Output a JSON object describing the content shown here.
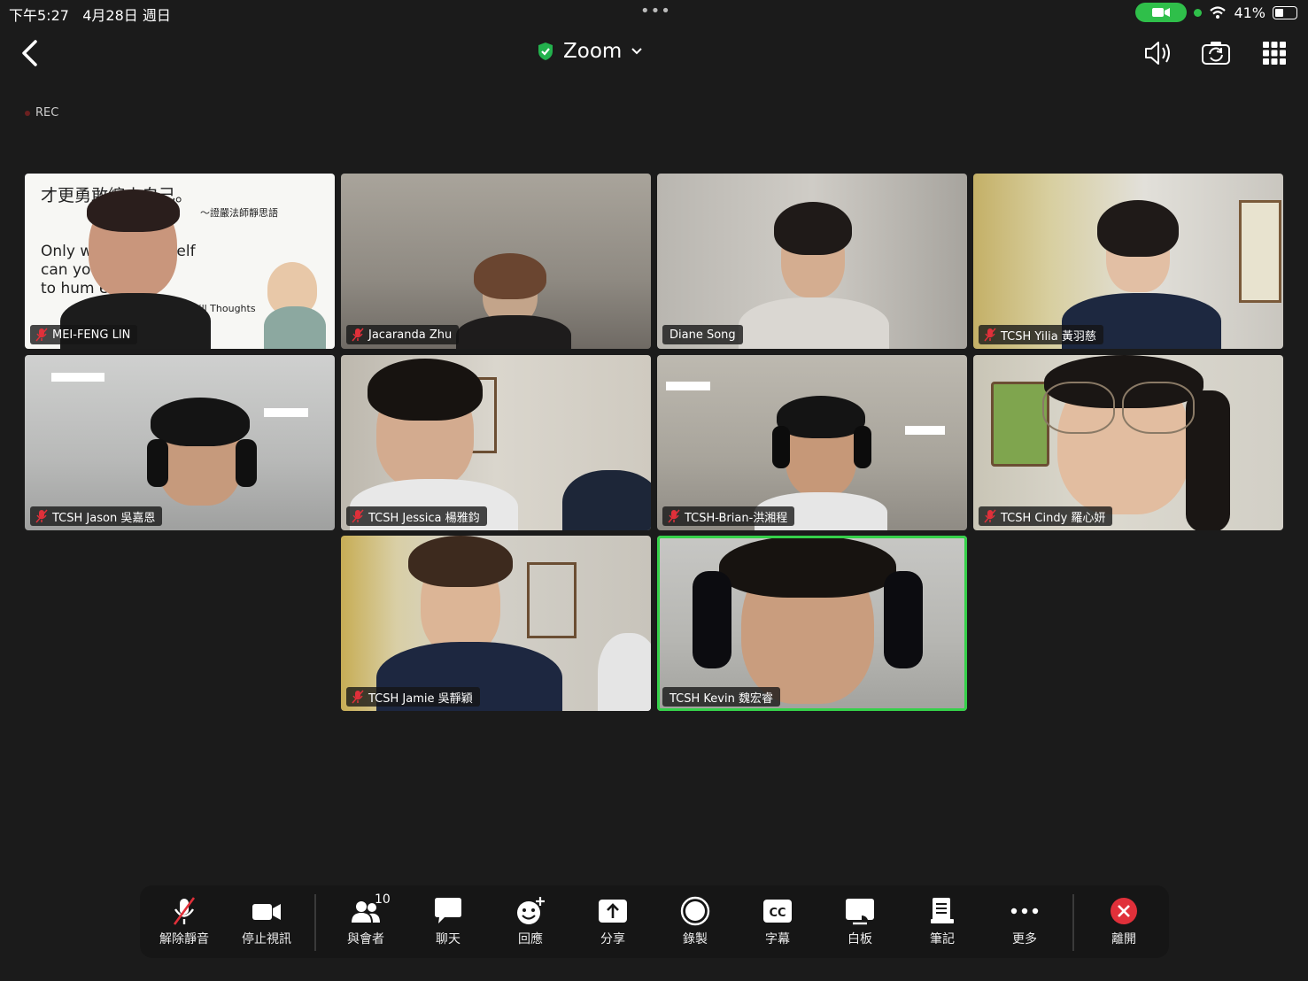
{
  "status": {
    "time": "下午5:27",
    "date": "4月28日 週日",
    "battery": "41%"
  },
  "header": {
    "title": "Zoom",
    "rec_label": "REC"
  },
  "participants": [
    {
      "name": "MEI-FENG LIN",
      "muted": true
    },
    {
      "name": "Jacaranda Zhu",
      "muted": true
    },
    {
      "name": "Diane Song",
      "muted": false
    },
    {
      "name": "TCSH Yilia 黃羽慈",
      "muted": true
    },
    {
      "name": "TCSH Jason 吳嘉恩",
      "muted": true
    },
    {
      "name": "TCSH Jessica 楊雅鈞",
      "muted": true
    },
    {
      "name": "TCSH-Brian-洪湘程",
      "muted": true
    },
    {
      "name": "TCSH Cindy 羅心妍",
      "muted": true
    },
    {
      "name": "TCSH Jamie 吳靜穎",
      "muted": true
    },
    {
      "name": "TCSH Kevin 魏宏睿",
      "muted": false,
      "active_speaker": true
    }
  ],
  "slide": {
    "line1": "才更勇敢縮小自己。",
    "attribution_zh": "～證嚴法師靜思語",
    "line_en1": "Only w        pect yourself",
    "line_en2": "can yo        courage",
    "line_en3": "to hum        elf.",
    "attribution_en": "~Still Thoughts"
  },
  "toolbar": {
    "unmute": "解除靜音",
    "stop_video": "停止視訊",
    "participants": "與會者",
    "participants_count": "10",
    "chat": "聊天",
    "react": "回應",
    "share": "分享",
    "record": "錄製",
    "captions": "字幕",
    "whiteboard": "白板",
    "notes": "筆記",
    "more": "更多",
    "leave": "離開"
  },
  "colors": {
    "background": "#1b1b1b",
    "active_border": "#35d14a",
    "leave_red": "#e0303a",
    "mute_red": "#e0303a"
  }
}
